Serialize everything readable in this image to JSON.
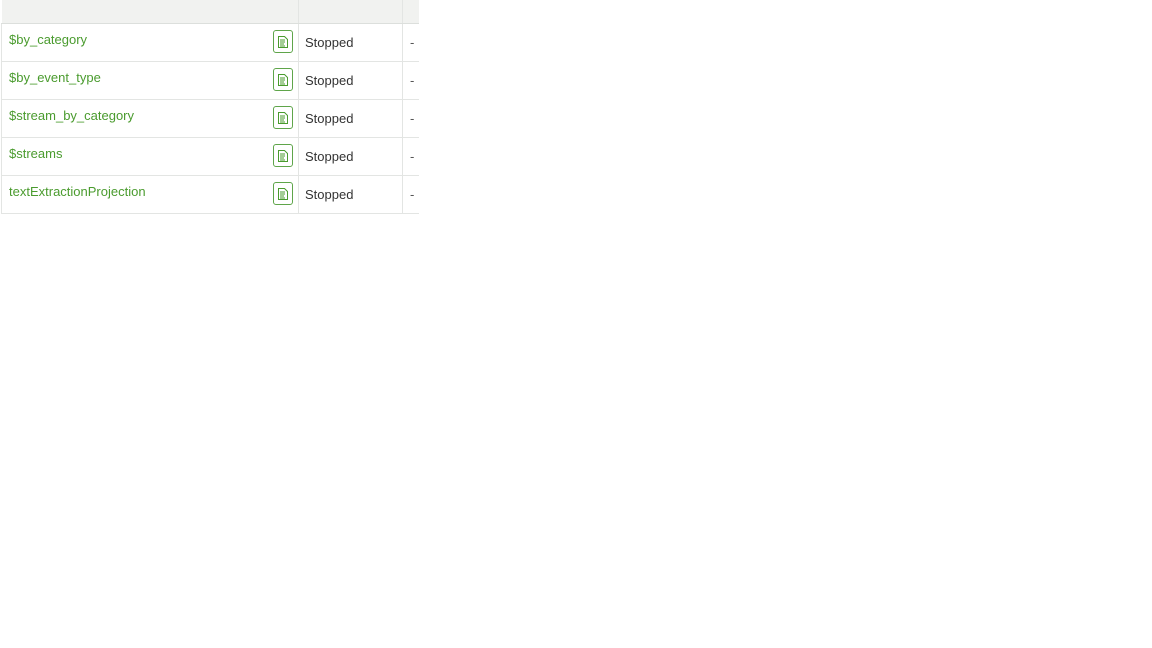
{
  "table": {
    "rows": [
      {
        "name": "$by_category",
        "status": "Stopped",
        "extra": "-"
      },
      {
        "name": "$by_event_type",
        "status": "Stopped",
        "extra": "-"
      },
      {
        "name": "$stream_by_category",
        "status": "Stopped",
        "extra": "-"
      },
      {
        "name": "$streams",
        "status": "Stopped",
        "extra": "-"
      },
      {
        "name": "textExtractionProjection",
        "status": "Stopped",
        "extra": "-"
      }
    ]
  },
  "icons": {
    "copy": "document-copy-icon"
  },
  "colors": {
    "accent": "#4a9b2e",
    "header_bg": "#f1f2f0"
  }
}
